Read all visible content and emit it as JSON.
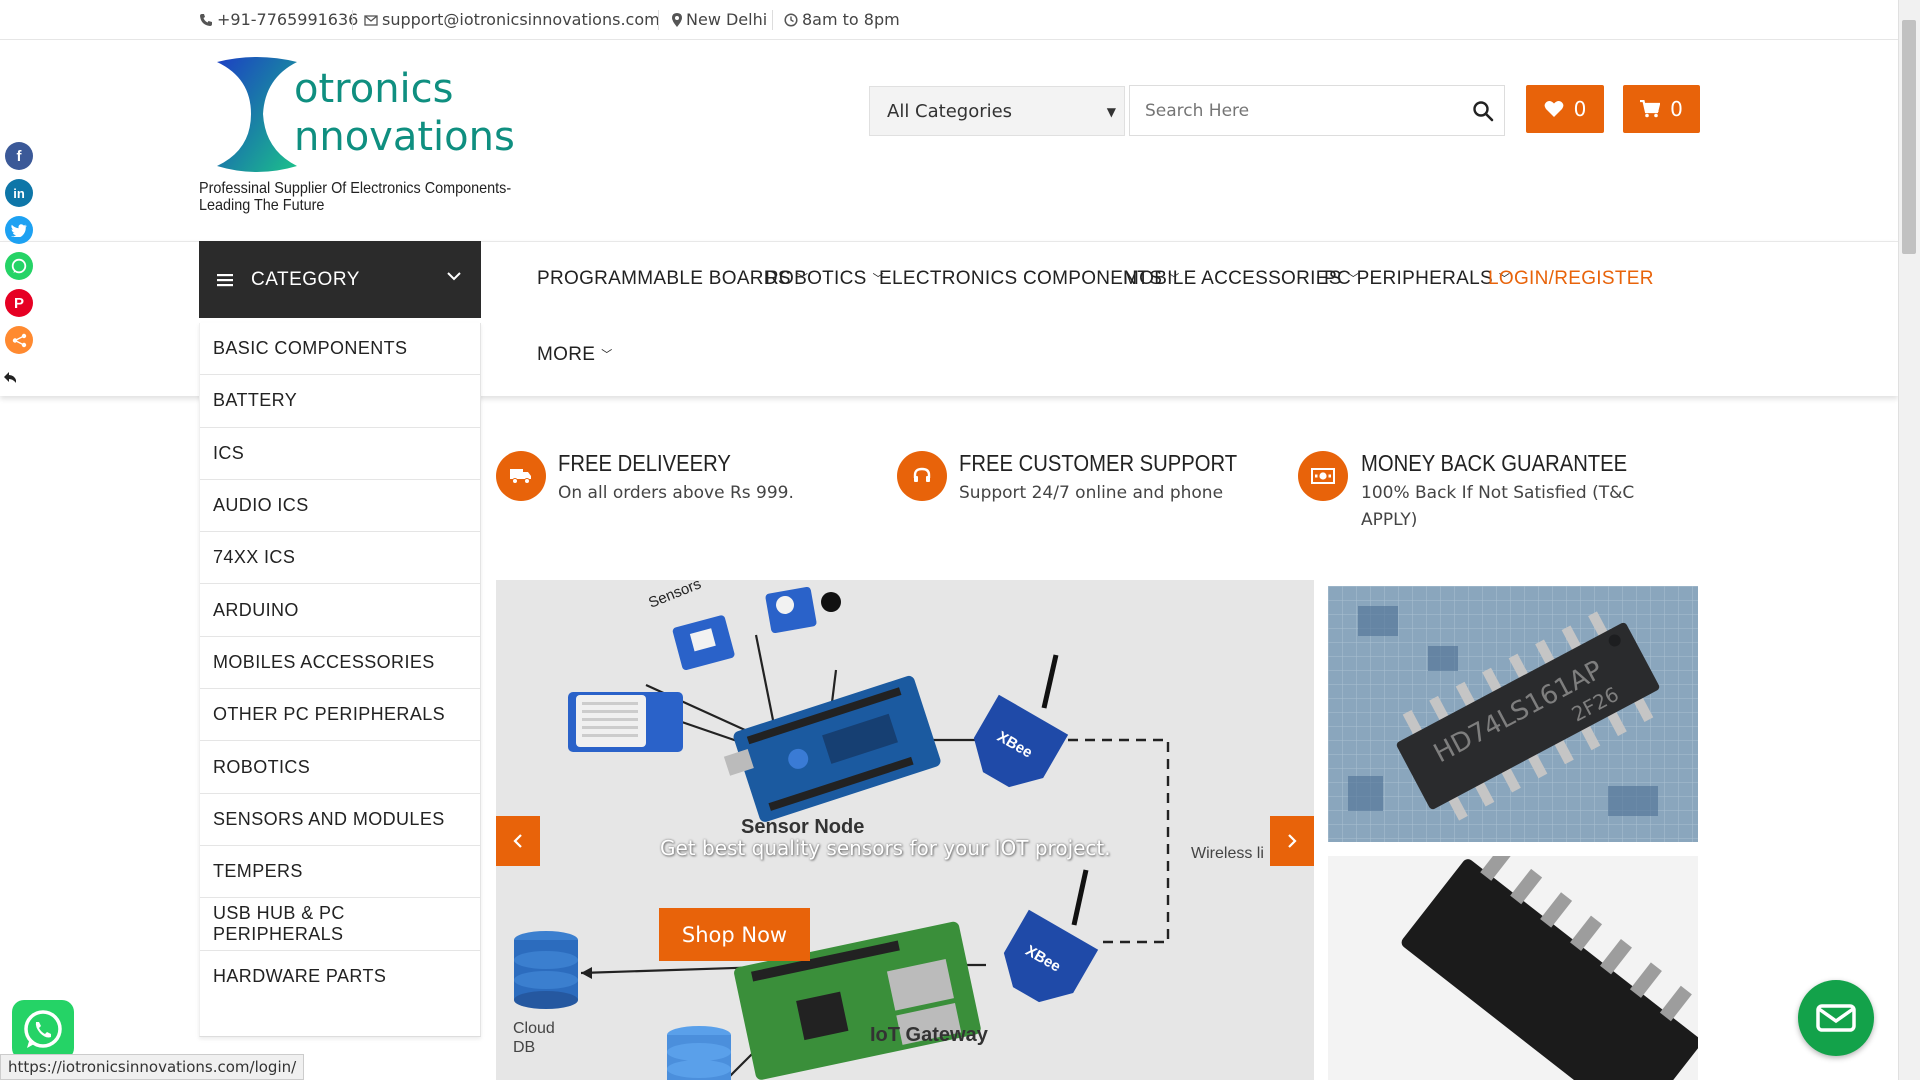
{
  "topbar": {
    "phone": "+91-7765991636",
    "email": "support@iotronicsinnovations.com",
    "location": "New Delhi",
    "hours": "8am to 8pm"
  },
  "brand": {
    "name_line1": "otronics",
    "name_line2": "nnovations",
    "tagline_line1": "Professinal Supplier Of Electronics Components-",
    "tagline_line2": "Leading The Future",
    "color": "#0f8f80"
  },
  "header": {
    "category_select": "All Categories",
    "search_placeholder": "Search Here",
    "wishlist_count": "0",
    "cart_count": "0",
    "accent": "#e8630a"
  },
  "nav": {
    "category_label": "CATEGORY",
    "items": [
      {
        "label": "PROGRAMMABLE BOARDS"
      },
      {
        "label": "ROBOTICS"
      },
      {
        "label": "ELECTRONICS COMPONENTS"
      },
      {
        "label": "MOBILE ACCESSORIES"
      },
      {
        "label": "PC PERIPHERALS"
      },
      {
        "label": "LOGIN/REGISTER"
      },
      {
        "label": "MORE"
      }
    ]
  },
  "categories": [
    "BASIC COMPONENTS",
    "BATTERY",
    "ICS",
    "AUDIO ICS",
    "74XX ICS",
    "ARDUINO",
    "MOBILES ACCESSORIES",
    "OTHER PC PERIPHERALS",
    "ROBOTICS",
    "SENSORS AND MODULES",
    "TEMPERS",
    "USB HUB & PC PERIPHERALS",
    "HARDWARE PARTS"
  ],
  "features": [
    {
      "title": "FREE DELIVEERY",
      "sub": "On all orders above Rs 999.",
      "icon": "truck-icon"
    },
    {
      "title": "FREE CUSTOMER SUPPORT",
      "sub": "Support 24/7 online and phone",
      "icon": "headset-icon"
    },
    {
      "title": "MONEY BACK GUARANTEE",
      "sub": "100% Back If Not Satisfied (T&C APPLY)",
      "icon": "money-icon"
    }
  ],
  "banner": {
    "subtitle": "Get best quality sensors for your IOT project.",
    "button": "Shop Now",
    "diagram_labels": {
      "sensors": "Sensors",
      "sensor_node": "Sensor Node",
      "wireless": "Wireless li",
      "cloud_db_1": "Cloud",
      "cloud_db_2": "DB",
      "gateway": "IoT Gateway",
      "xbee": "XBee"
    }
  },
  "side_images": {
    "chip_text_1": "HD74LS161AP",
    "chip_text_2": "2F26"
  },
  "status_url": "https://iotronicsinnovations.com/login/"
}
